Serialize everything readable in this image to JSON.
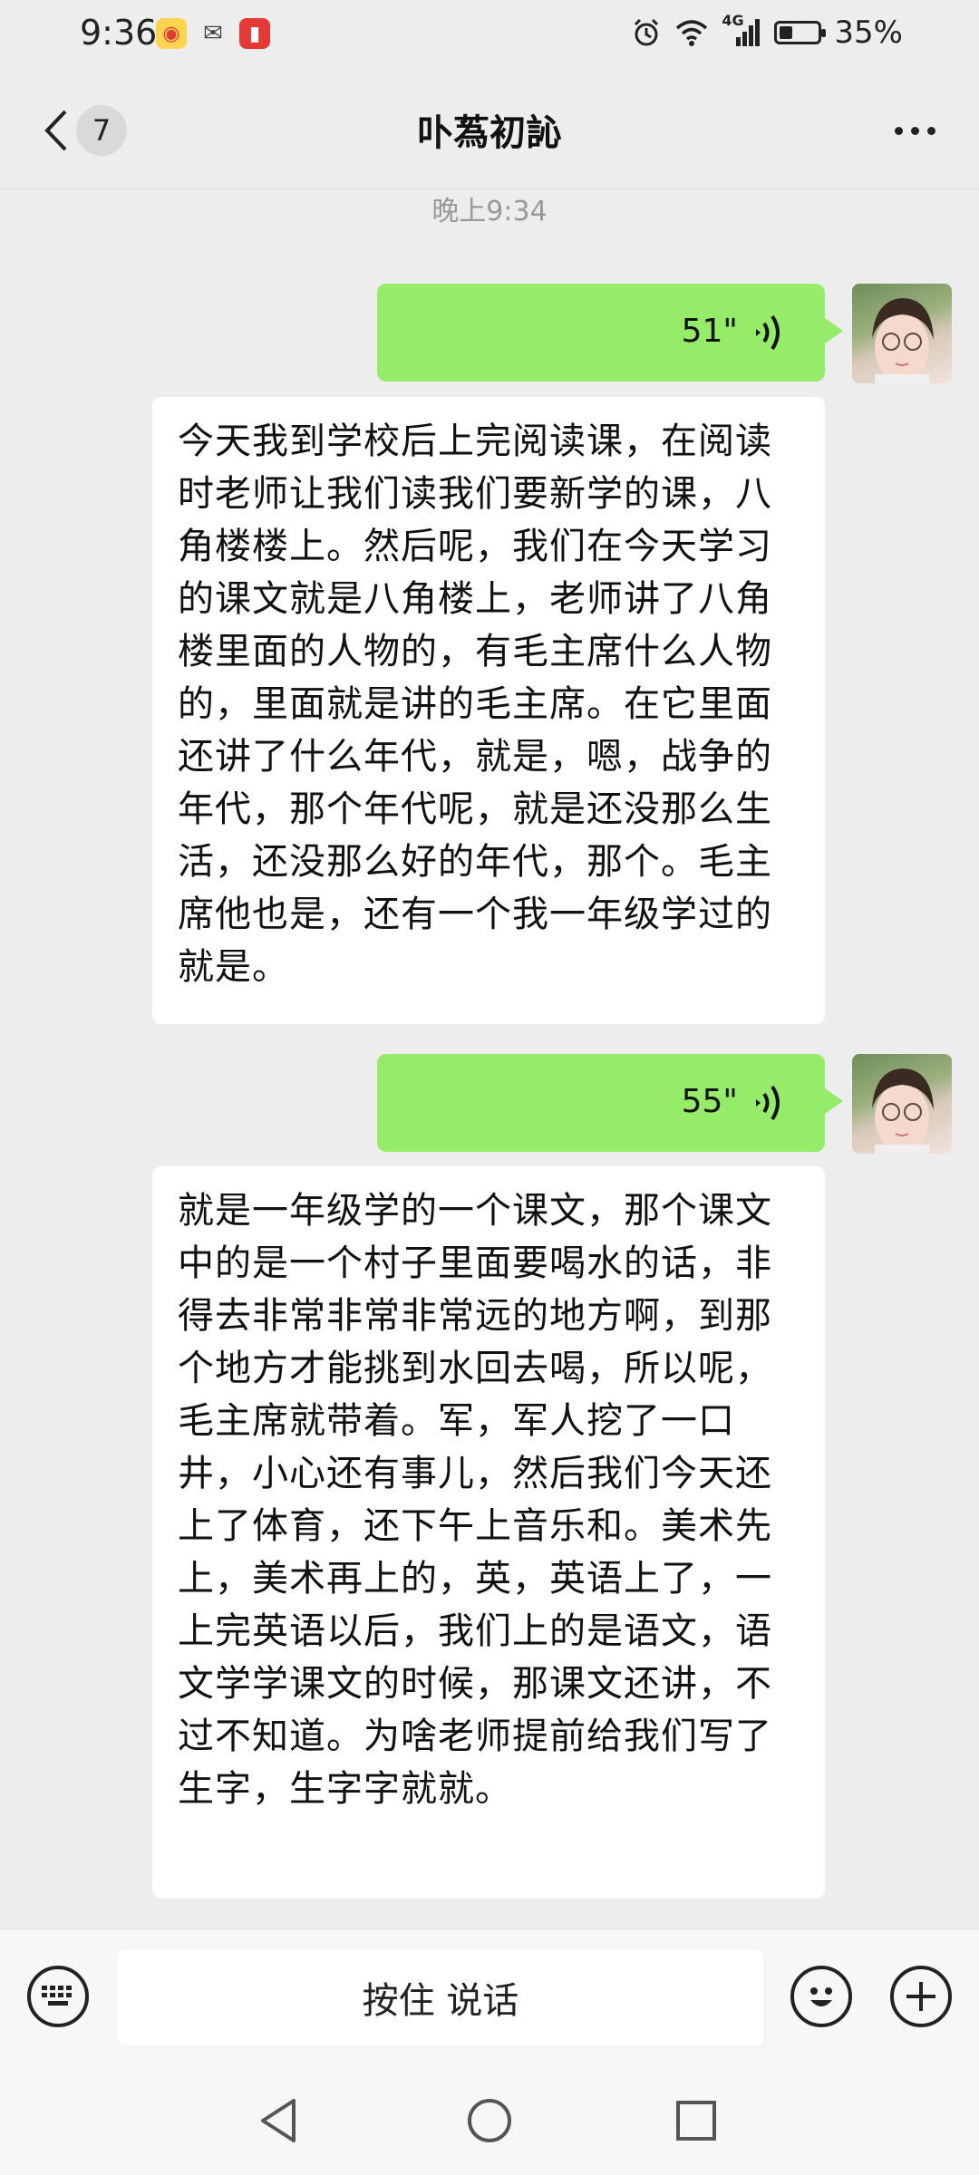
{
  "status_bar": {
    "time": "9:36",
    "network": "4G",
    "battery_percent": "35%",
    "battery_level": 0.35,
    "left_icons": [
      "weibo-icon",
      "wechat-icon",
      "red-book-icon"
    ],
    "right_icons": [
      "alarm-icon",
      "wifi-icon",
      "signal-icon",
      "battery-icon"
    ]
  },
  "header": {
    "back_icon": "chevron-left-icon",
    "unread_count": "7",
    "title": "卟蒍初訫",
    "more_icon": "ellipsis-icon"
  },
  "timestamp": "晚上9:34",
  "messages": [
    {
      "type": "voice",
      "direction": "sent",
      "duration": "51\""
    },
    {
      "type": "text",
      "direction": "received",
      "text": "今天我到学校后上完阅读课，在阅读时老师让我们读我们要新学的课，八角楼楼上。然后呢，我们在今天学习的课文就是八角楼上，老师讲了八角楼里面的人物的，有毛主席什么人物的，里面就是讲的毛主席。在它里面还讲了什么年代，就是，嗯，战争的年代，那个年代呢，就是还没那么生活，还没那么好的年代，那个。毛主席他也是，还有一个我一年级学过的就是。"
    },
    {
      "type": "voice",
      "direction": "sent",
      "duration": "55\""
    },
    {
      "type": "text",
      "direction": "received",
      "text": "就是一年级学的一个课文，那个课文中的是一个村子里面要喝水的话，非得去非常非常非常远的地方啊，到那个地方才能挑到水回去喝，所以呢，毛主席就带着。军，军人挖了一口井，小心还有事儿，然后我们今天还上了体育，还下午上音乐和。美术先上，美术再上的，英，英语上了，一上完英语以后，我们上的是语文，语文学学课文的时候，那课文还讲，不过不知道。为啥老师提前给我们写了生字，生字字就就。"
    }
  ],
  "input_bar": {
    "keyboard_icon": "keyboard-icon",
    "hold_to_talk": "按住 说话",
    "emoji_icon": "emoji-icon",
    "add_icon": "plus-icon"
  },
  "nav_bar": {
    "icons": [
      "back-triangle-icon",
      "home-circle-icon",
      "recents-square-icon"
    ]
  },
  "colors": {
    "background": "#ededed",
    "sent_bubble": "#95ec69",
    "received_bubble": "#ffffff"
  }
}
